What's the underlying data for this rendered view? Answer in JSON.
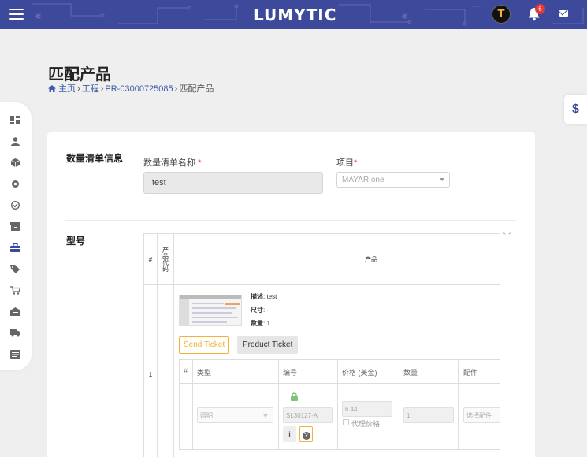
{
  "topbar": {
    "logo": "LUMYTIC",
    "avatar_letter": "T",
    "notification_count": "6"
  },
  "page": {
    "title": "匹配产品",
    "breadcrumb": [
      "主页",
      "工程",
      "PR-03000725085",
      "匹配产品"
    ]
  },
  "sidebar": {
    "icons": [
      "dashboard-icon",
      "user-icon",
      "cube-icon",
      "settings-icon",
      "check-circle-icon",
      "archive-icon",
      "briefcase-icon",
      "tag-icon",
      "cart-icon",
      "warehouse-icon",
      "truck-icon",
      "list-icon"
    ],
    "active": "briefcase-icon"
  },
  "right_tab": {
    "label": "$"
  },
  "bom_section": {
    "label": "数量清单信息",
    "name_label": "数量清单名称",
    "name_required": "*",
    "name_value": "test",
    "project_label": "项目",
    "project_required": "*",
    "project_value": "MAYAR one"
  },
  "model_section": {
    "label": "型号",
    "table": {
      "headers": {
        "index": "#",
        "code": "产品代码",
        "product": "产品"
      },
      "row": {
        "index": "1",
        "description_label": "描述",
        "description": "test",
        "size_label": "尺寸",
        "size": "-",
        "qty_label": "数量",
        "qty": "1",
        "send_ticket": "Send Ticket",
        "product_ticket": "Product Ticket"
      },
      "sub_headers": [
        "#",
        "类型",
        "编号",
        "价格 (美金)",
        "数量",
        "配件"
      ],
      "sub_row": {
        "type_placeholder": "照明",
        "code": "SL30127-A",
        "price": "6.44",
        "agent_price_label": "代理价格",
        "quantity": "1",
        "accessory_placeholder": "选择配件",
        "info_label": "i",
        "help_label": "?"
      }
    }
  },
  "colors": {
    "brand": "#3d4a9c",
    "accent": "#f2b233",
    "badge": "#e53935",
    "lock": "#7cc576"
  }
}
